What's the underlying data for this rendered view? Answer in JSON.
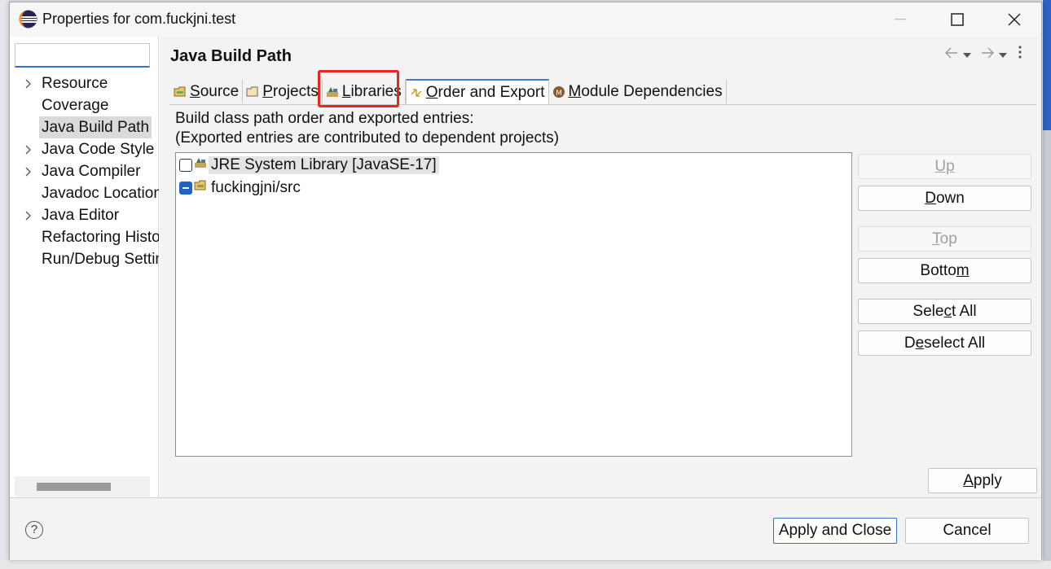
{
  "window": {
    "title": "Properties for com.fuckjni.test"
  },
  "sidebar": {
    "filter_value": "",
    "items": [
      {
        "label": "Resource",
        "expandable": true
      },
      {
        "label": "Coverage",
        "expandable": false
      },
      {
        "label": "Java Build Path",
        "expandable": false,
        "selected": true
      },
      {
        "label": "Java Code Style",
        "expandable": true
      },
      {
        "label": "Java Compiler",
        "expandable": true
      },
      {
        "label": "Javadoc Location",
        "expandable": false
      },
      {
        "label": "Java Editor",
        "expandable": true
      },
      {
        "label": "Refactoring History",
        "expandable": false
      },
      {
        "label": "Run/Debug Settings",
        "expandable": false
      }
    ]
  },
  "main": {
    "page_title": "Java Build Path",
    "tabs": [
      {
        "label": "Source",
        "mnemonic_index": 0,
        "icon": "source-folder-icon"
      },
      {
        "label": "Projects",
        "mnemonic_index": 0,
        "icon": "projects-icon"
      },
      {
        "label": "Libraries",
        "mnemonic_index": 0,
        "icon": "libraries-icon",
        "highlighted": true
      },
      {
        "label": "Order and Export",
        "mnemonic_index": 0,
        "icon": "order-export-icon",
        "active": true
      },
      {
        "label": "Module Dependencies",
        "mnemonic_index": 0,
        "icon": "module-icon"
      }
    ],
    "description_line1": "Build class path order and exported entries:",
    "description_line2": "(Exported entries are contributed to dependent projects)",
    "entries": [
      {
        "label": "JRE System Library [JavaSE-17]",
        "checked": false,
        "icon": "library-icon"
      },
      {
        "label": "fuckingjni/src",
        "checked": "partial",
        "icon": "source-folder-icon"
      }
    ],
    "buttons": {
      "up": "Up",
      "down": "Down",
      "top": "Top",
      "bottom": "Bottom",
      "select_all": "Select All",
      "deselect_all": "Deselect All"
    },
    "apply": "Apply"
  },
  "footer": {
    "apply_and_close": "Apply and Close",
    "cancel": "Cancel",
    "help": "?"
  },
  "colors": {
    "accent": "#2f74c7",
    "highlight_box": "#e8251e",
    "checkbox_partial": "#1f63c6"
  }
}
